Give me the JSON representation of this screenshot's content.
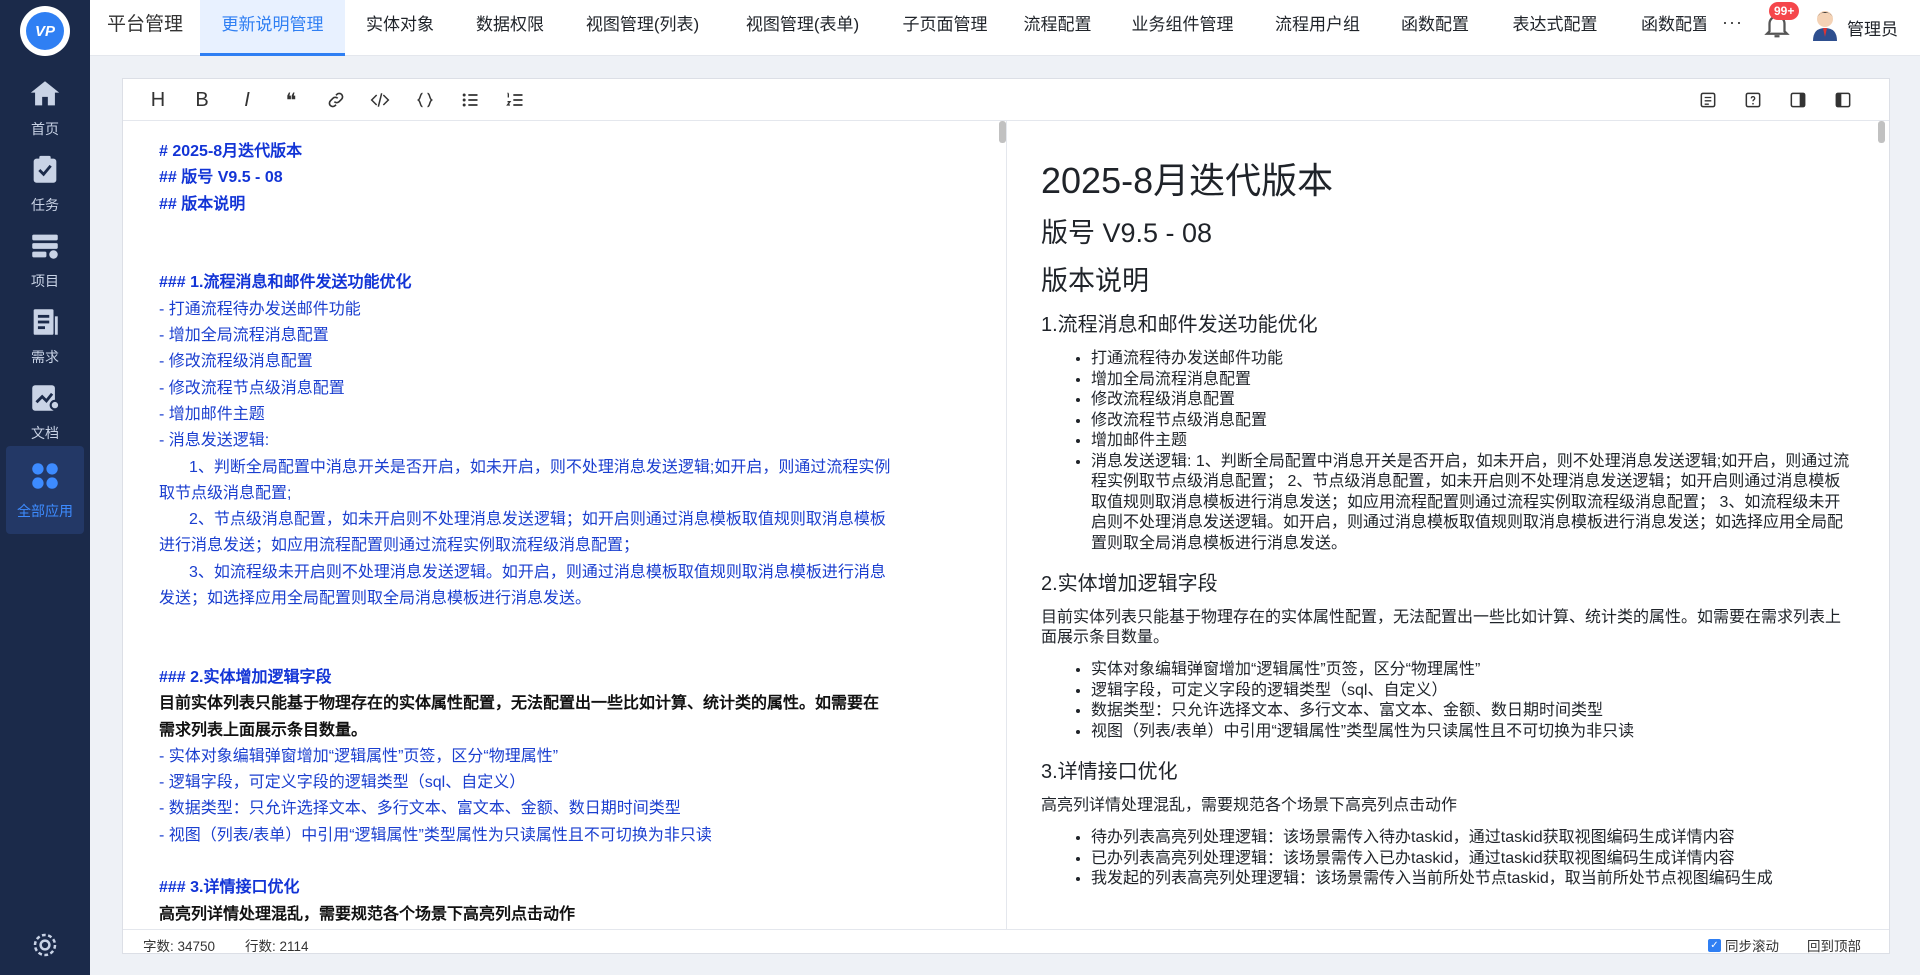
{
  "sidebar": {
    "logo_text": "VP",
    "items": [
      {
        "label": "首页",
        "icon": "home-icon"
      },
      {
        "label": "任务",
        "icon": "task-icon"
      },
      {
        "label": "项目",
        "icon": "project-icon"
      },
      {
        "label": "需求",
        "icon": "requirement-icon"
      },
      {
        "label": "文档",
        "icon": "document-icon"
      },
      {
        "label": "全部应用",
        "icon": "apps-icon"
      }
    ],
    "settings_icon": "gear-icon"
  },
  "tabs": [
    "平台管理",
    "更新说明管理",
    "实体对象",
    "数据权限",
    "视图管理(列表)",
    "视图管理(表单)",
    "子页面管理",
    "流程配置",
    "业务组件管理",
    "流程用户组",
    "函数配置",
    "表达式配置",
    "函数配置"
  ],
  "header": {
    "more": "···",
    "notification_badge": "99+",
    "user_name": "管理员"
  },
  "toolbar": {
    "heading": "H",
    "bold": "B",
    "italic": "I",
    "quote": "❝"
  },
  "source": {
    "l1": "# 2025-8月迭代版本",
    "l2": "## 版号 V9.5 - 08",
    "l3": "## 版本说明",
    "l4": "### 1.流程消息和邮件发送功能优化",
    "l5": "- 打通流程待办发送邮件功能",
    "l6": "- 增加全局流程消息配置",
    "l7": "- 修改流程级消息配置",
    "l8": "- 修改流程节点级消息配置",
    "l9": "- 增加邮件主题",
    "l10": "- 消息发送逻辑:",
    "l11": "1、判断全局配置中消息开关是否开启，如未开启，则不处理消息发送逻辑;如开启，则通过流程实例",
    "l12": "取节点级消息配置;",
    "l13": "2、节点级消息配置，如未开启则不处理消息发送逻辑；如开启则通过消息模板取值规则取消息模板",
    "l14": "进行消息发送；如应用流程配置则通过流程实例取流程级消息配置；",
    "l15": "3、如流程级未开启则不处理消息发送逻辑。如开启，则通过消息模板取值规则取消息模板进行消息",
    "l16": "发送；如选择应用全局配置则取全局消息模板进行消息发送。",
    "l17": "### 2.实体增加逻辑字段",
    "l18": "目前实体列表只能基于物理存在的实体属性配置，无法配置出一些比如计算、统计类的属性。如需要在",
    "l19": "需求列表上面展示条目数量。",
    "l20": "-  实体对象编辑弹窗增加“逻辑属性”页签，区分“物理属性”",
    "l21": "- 逻辑字段，可定义字段的逻辑类型（sql、自定义）",
    "l22": "- 数据类型：只允许选择文本、多行文本、富文本、金额、数日期时间类型",
    "l23": "- 视图（列表/表单）中引用“逻辑属性”类型属性为只读属性且不可切换为非只读",
    "l24": "### 3.详情接口优化",
    "l25": "高亮列详情处理混乱，需要规范各个场景下高亮列点击动作"
  },
  "preview": {
    "h1": "2025-8月迭代版本",
    "h2a": "版号 V9.5 - 08",
    "h2b": "版本说明",
    "s1_title": "1.流程消息和邮件发送功能优化",
    "s1_items": [
      "打通流程待办发送邮件功能",
      "增加全局流程消息配置",
      "修改流程级消息配置",
      "修改流程节点级消息配置",
      "增加邮件主题",
      "消息发送逻辑: 1、判断全局配置中消息开关是否开启，如未开启，则不处理消息发送逻辑;如开启，则通过流程实例取节点级消息配置； 2、节点级消息配置，如未开启则不处理消息发送逻辑；如开启则通过消息模板取值规则取消息模板进行消息发送；如应用流程配置则通过流程实例取流程级消息配置； 3、如流程级未开启则不处理消息发送逻辑。如开启，则通过消息模板取值规则取消息模板进行消息发送；如选择应用全局配置则取全局消息模板进行消息发送。"
    ],
    "s2_title": "2.实体增加逻辑字段",
    "s2_para": "目前实体列表只能基于物理存在的实体属性配置，无法配置出一些比如计算、统计类的属性。如需要在需求列表上面展示条目数量。",
    "s2_items": [
      "实体对象编辑弹窗增加“逻辑属性”页签，区分“物理属性”",
      "逻辑字段，可定义字段的逻辑类型（sql、自定义）",
      "数据类型：只允许选择文本、多行文本、富文本、金额、数日期时间类型",
      "视图（列表/表单）中引用“逻辑属性”类型属性为只读属性且不可切换为非只读"
    ],
    "s3_title": "3.详情接口优化",
    "s3_para": "高亮列详情处理混乱，需要规范各个场景下高亮列点击动作",
    "s3_items": [
      "待办列表高亮列处理逻辑：该场景需传入待办taskid，通过taskid获取视图编码生成详情内容",
      "已办列表高亮列处理逻辑：该场景需传入已办taskid，通过taskid获取视图编码生成详情内容",
      "我发起的列表高亮列处理逻辑：该场景需传入当前所处节点taskid，取当前所处节点视图编码生成"
    ]
  },
  "footer": {
    "word_count": "字数: 34750",
    "line_count": "行数: 2114",
    "sync_scroll": "同步滚动",
    "back_to_top": "回到顶部"
  },
  "colors": {
    "sidebar_bg": "#1b2a4a",
    "accent": "#2f7ff3",
    "markdown_text": "#1a3ecf",
    "badge": "#f5464b"
  }
}
